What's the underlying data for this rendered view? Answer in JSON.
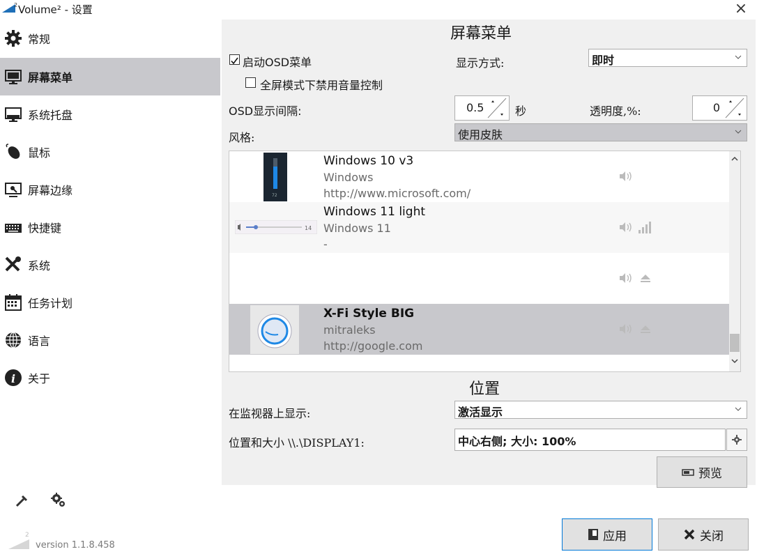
{
  "window": {
    "title": "Volume² - 设置",
    "close_glyph": "×"
  },
  "sidebar": {
    "items": [
      {
        "label": "常规",
        "icon": "gear-icon"
      },
      {
        "label": "屏幕菜单",
        "icon": "monitor-icon",
        "active": true
      },
      {
        "label": "系统托盘",
        "icon": "tray-icon"
      },
      {
        "label": "鼠标",
        "icon": "mouse-icon"
      },
      {
        "label": "屏幕边缘",
        "icon": "screen-edge-icon"
      },
      {
        "label": "快捷键",
        "icon": "keyboard-icon"
      },
      {
        "label": "系统",
        "icon": "tools-icon"
      },
      {
        "label": "任务计划",
        "icon": "calendar-icon"
      },
      {
        "label": "语言",
        "icon": "globe-icon"
      },
      {
        "label": "关于",
        "icon": "info-icon"
      }
    ],
    "version": "version 1.1.8.458"
  },
  "osd": {
    "section_title": "屏幕菜单",
    "enable_label": "启动OSD菜单",
    "enable_checked": true,
    "fullscreen_label": "全屏模式下禁用音量控制",
    "fullscreen_checked": false,
    "display_mode_label": "显示方式:",
    "display_mode_value": "即时",
    "interval_label": "OSD显示间隔:",
    "interval_value": "0.5",
    "interval_unit": "秒",
    "opacity_label": "透明度,%:",
    "opacity_value": "0",
    "style_label": "风格:",
    "style_value": "使用皮肤"
  },
  "skins": [
    {
      "name": "Windows 10 v3",
      "author": "Windows",
      "url": "http://www.microsoft.com/",
      "thumb_text": "72"
    },
    {
      "name": "Windows 11 light",
      "author": "Windows 11",
      "url": "-",
      "thumb_text": "14"
    },
    {
      "name": "",
      "author": "",
      "url": ""
    },
    {
      "name": "X-Fi Style BIG",
      "author": "mitraleks",
      "url": "http://google.com",
      "selected": true
    }
  ],
  "position": {
    "section_title": "位置",
    "monitor_label": "在监视器上显示:",
    "monitor_value": "激活显示",
    "size_label": "位置和大小 \\\\.\\DISPLAY1:",
    "size_value": "中心右侧; 大小: 100%",
    "preview_label": "预览"
  },
  "footer": {
    "apply_label": "应用",
    "close_label": "关闭"
  },
  "colors": {
    "selected_bg": "#c8c8cc",
    "panel_bg": "#f0f0f0",
    "accent": "#0078d7"
  }
}
